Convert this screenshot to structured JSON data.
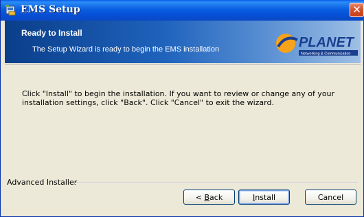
{
  "window": {
    "title": "EMS Setup",
    "close_label": "✕"
  },
  "banner": {
    "title": "Ready to Install",
    "subtitle": "The Setup Wizard is ready to begin the EMS installation",
    "logo_text": "PLANET",
    "logo_tagline": "Networking & Communication"
  },
  "content": {
    "message": "Click \"Install\" to begin the installation.  If you want to review or change any of your installation settings, click \"Back\".  Click \"Cancel\" to exit the wizard."
  },
  "footer": {
    "group_label": "Advanced Installer",
    "back_prefix": "< ",
    "back_mnemonic": "B",
    "back_rest": "ack",
    "install_mnemonic": "I",
    "install_rest": "nstall",
    "cancel_label": "Cancel"
  },
  "icons": {
    "title_icon": "installer-icon",
    "close_icon": "close-icon"
  },
  "colors": {
    "titlebar": "#0a5fe0",
    "banner_start": "#0a3e8a",
    "banner_end": "#9fc0e6",
    "dialog_bg": "#ece9d8",
    "close_button": "#d4502a"
  }
}
